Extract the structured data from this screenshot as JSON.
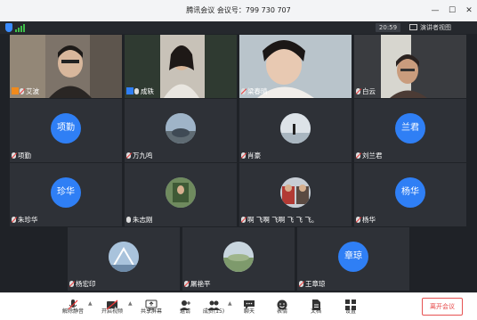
{
  "window": {
    "title": "腾讯会议 会议号：799 730 707",
    "controls": [
      "—",
      "☐",
      "✕"
    ]
  },
  "subbar": {
    "time": "20:59",
    "speaker_view_label": "演讲者视图"
  },
  "participants": [
    {
      "name": "艾波",
      "type": "video",
      "muted": true,
      "host": "orange"
    },
    {
      "name": "成轶",
      "type": "video",
      "muted": false,
      "host": "blue",
      "active": true
    },
    {
      "name": "梁春晴",
      "type": "video",
      "muted": true
    },
    {
      "name": "白云",
      "type": "video",
      "muted": true
    },
    {
      "name": "项勤",
      "type": "avatar",
      "avatar_text": "项勤",
      "muted": true
    },
    {
      "name": "万九鸣",
      "type": "photo",
      "muted": true
    },
    {
      "name": "肖豪",
      "type": "photo",
      "muted": true
    },
    {
      "name": "刘兰君",
      "type": "avatar",
      "avatar_text": "兰君",
      "muted": true
    },
    {
      "name": "朱珍华",
      "type": "avatar",
      "avatar_text": "珍华",
      "muted": true
    },
    {
      "name": "朱志刚",
      "type": "photo",
      "muted": false
    },
    {
      "name": "啊 飞啊 飞啊 飞 飞 飞。",
      "type": "photo",
      "muted": true
    },
    {
      "name": "杨华",
      "type": "avatar",
      "avatar_text": "杨华",
      "muted": true
    },
    {
      "name": "杨宏印",
      "type": "photo",
      "muted": true
    },
    {
      "name": "屠艳平",
      "type": "photo",
      "muted": true
    },
    {
      "name": "王章琼",
      "type": "avatar",
      "avatar_text": "章琼",
      "muted": true
    }
  ],
  "toolbar": {
    "unmute": "解除静音",
    "start_video": "开启视频",
    "share_screen": "共享屏幕",
    "invite": "邀请",
    "members": "成员(15)",
    "chat": "聊天",
    "reactions": "表情",
    "docs": "文档",
    "settings": "设置",
    "leave": "离开会议"
  },
  "colors": {
    "accent": "#2f7ff5",
    "active_border": "#3fb34f",
    "leave_red": "#e64545"
  }
}
